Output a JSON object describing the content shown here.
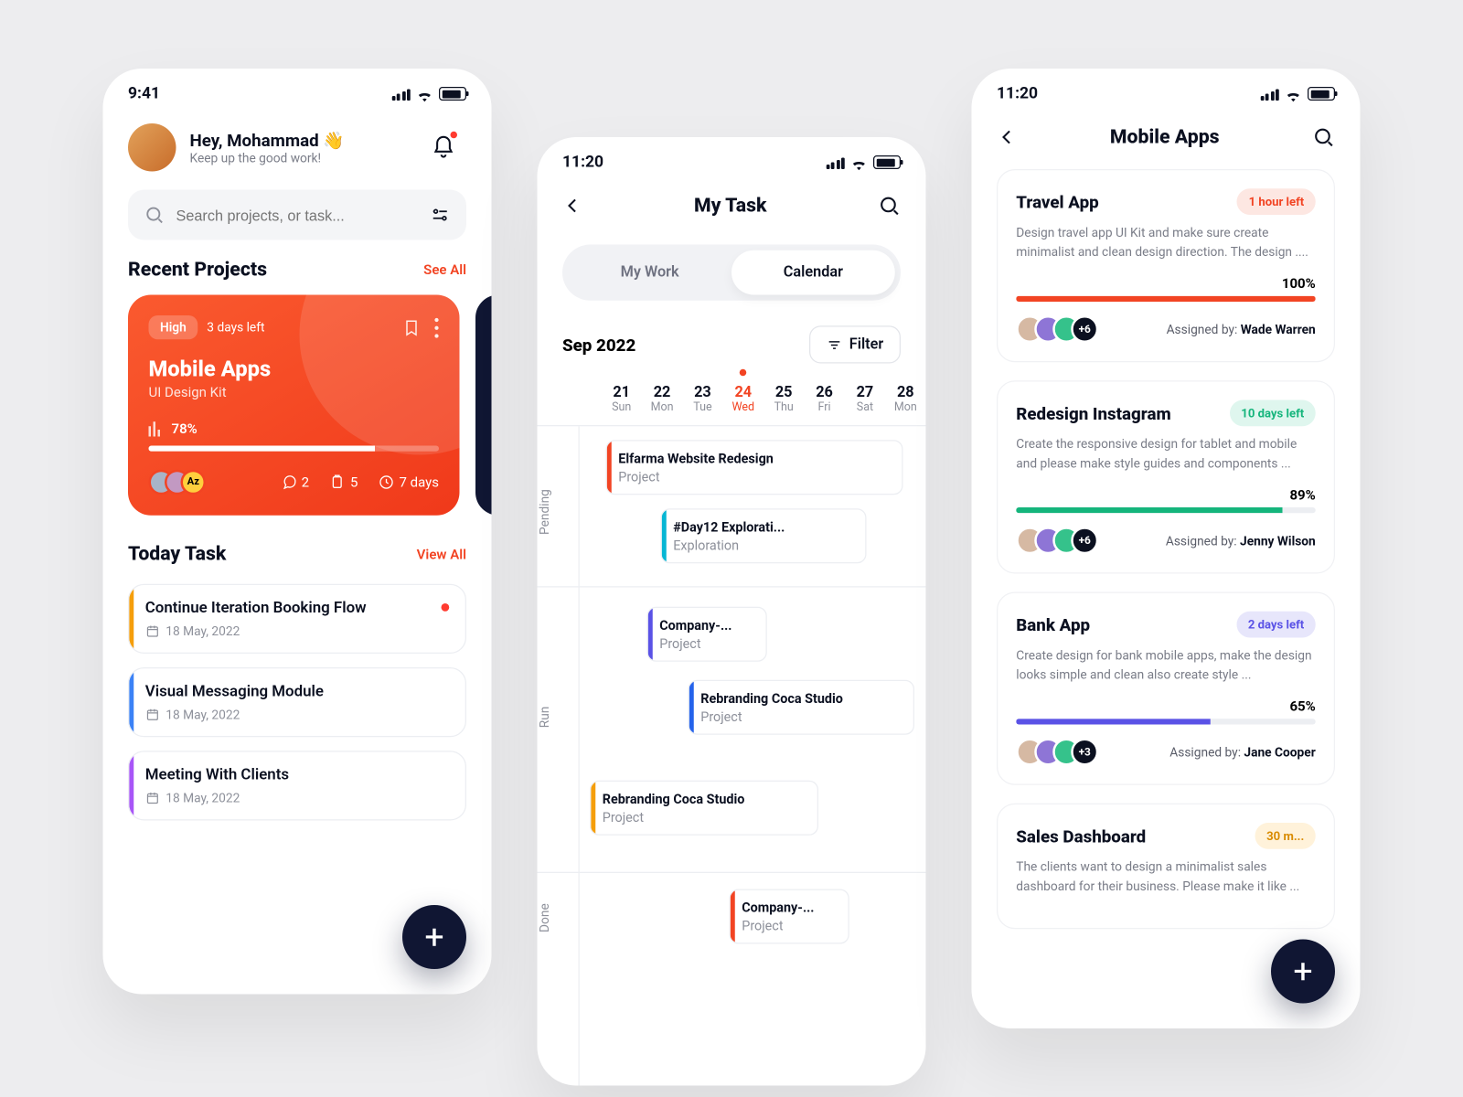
{
  "home": {
    "clock": "9:41",
    "greeting": "Hey, Mohammad 👋",
    "subline": "Keep up the good work!",
    "search_placeholder": "Search projects, or task...",
    "recent": {
      "title": "Recent Projects",
      "see_all": "See All",
      "card": {
        "priority": "High",
        "deadline": "3 days left",
        "name": "Mobile Apps",
        "sub": "UI Design Kit",
        "pct_label": "78%",
        "pct": 78,
        "avatar3": "Az",
        "comments": "2",
        "docs": "5",
        "duration": "7 days"
      }
    },
    "today": {
      "title": "Today Task",
      "view_all": "View All",
      "tasks": [
        {
          "title": "Continue Iteration Booking Flow",
          "date": "18 May, 2022",
          "dot": true
        },
        {
          "title": "Visual Messaging Module",
          "date": "18 May, 2022",
          "dot": false
        },
        {
          "title": "Meeting With Clients",
          "date": "18 May, 2022",
          "dot": false
        }
      ]
    }
  },
  "mytask": {
    "clock": "11:20",
    "title": "My Task",
    "tabs": {
      "work": "My Work",
      "calendar": "Calendar"
    },
    "month": "Sep 2022",
    "filter": "Filter",
    "days": [
      {
        "num": "21",
        "name": "Sun"
      },
      {
        "num": "22",
        "name": "Mon"
      },
      {
        "num": "23",
        "name": "Tue"
      },
      {
        "num": "24",
        "name": "Wed"
      },
      {
        "num": "25",
        "name": "Thu"
      },
      {
        "num": "26",
        "name": "Fri"
      },
      {
        "num": "27",
        "name": "Sat"
      },
      {
        "num": "28",
        "name": "Mon"
      }
    ],
    "lanes": {
      "pending": "Pending",
      "run": "Run",
      "done": "Done"
    },
    "items": [
      {
        "title": "Elfarma Website Redesign",
        "sub": "Project"
      },
      {
        "title": "#Day12 Explorati...",
        "sub": "Exploration"
      },
      {
        "title": "Company-...",
        "sub": "Project"
      },
      {
        "title": "Rebranding Coca Studio",
        "sub": "Project"
      },
      {
        "title": "Rebranding Coca Studio",
        "sub": "Project"
      },
      {
        "title": "Company-...",
        "sub": "Project"
      }
    ]
  },
  "apps": {
    "clock": "11:20",
    "title": "Mobile Apps",
    "cards": [
      {
        "name": "Travel App",
        "pill": "1 hour left",
        "pill_class": "pill-red",
        "desc": "Design travel app UI Kit and make sure create minimalist and clean design direction. The design ....",
        "pct_label": "100%",
        "pct": 100,
        "fill_class": "f-red",
        "more": "+6",
        "assigned_label": "Assigned by: ",
        "assigned": "Wade Warren"
      },
      {
        "name": "Redesign Instagram",
        "pill": "10 days left",
        "pill_class": "pill-green",
        "desc": "Create the responsive design for tablet and mobile and please make style guides and components ...",
        "pct_label": "89%",
        "pct": 89,
        "fill_class": "f-green",
        "more": "+6",
        "assigned_label": "Assigned by: ",
        "assigned": "Jenny Wilson"
      },
      {
        "name": "Bank App",
        "pill": "2 days left",
        "pill_class": "pill-blue",
        "desc": "Create design for bank mobile apps, make the design looks simple and clean also create style ...",
        "pct_label": "65%",
        "pct": 65,
        "fill_class": "f-blue",
        "more": "+3",
        "assigned_label": "Assigned by: ",
        "assigned": "Jane Cooper"
      },
      {
        "name": "Sales Dashboard",
        "pill": "30 m...",
        "pill_class": "pill-yellow",
        "desc": "The clients want to design a minimalist sales dashboard for their business. Please make it like ...",
        "pct_label": "",
        "pct": 0,
        "fill_class": "f-red",
        "more": "",
        "assigned_label": "",
        "assigned": ""
      }
    ]
  }
}
